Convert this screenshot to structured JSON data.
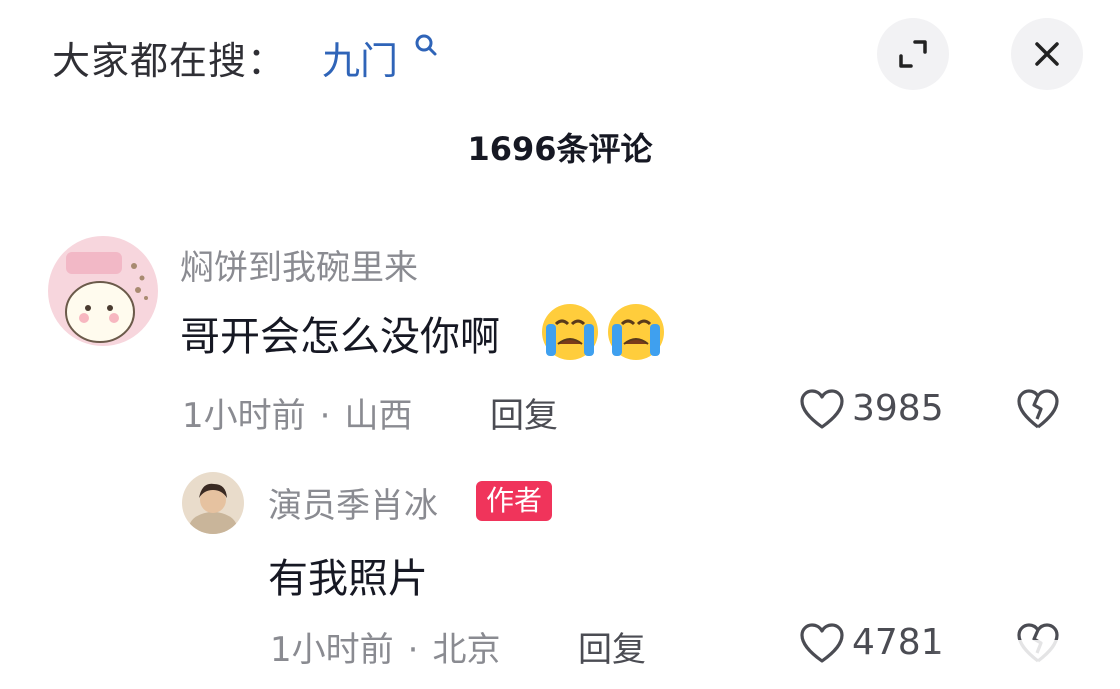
{
  "header": {
    "search_prefix": "大家都在搜：",
    "search_term": "九门",
    "icons": {
      "search": "search-icon",
      "expand": "expand-icon",
      "close": "close-icon"
    }
  },
  "comments_header": {
    "count_label": "1696条评论"
  },
  "comments": [
    {
      "username": "焖饼到我碗里来",
      "text": "哥开会怎么没你啊",
      "emoji": "crying-face-emoji",
      "time": "1小时前",
      "location": "山西",
      "reply_label": "回复",
      "likes": "3985"
    },
    {
      "username": "演员季肖冰",
      "badge": "作者",
      "text": "有我照片",
      "time": "1小时前",
      "location": "北京",
      "reply_label": "回复",
      "likes": "4781"
    }
  ],
  "colors": {
    "accent_blue": "#2f64b8",
    "badge_red": "#f0345b",
    "muted_text": "#8a8b91"
  }
}
